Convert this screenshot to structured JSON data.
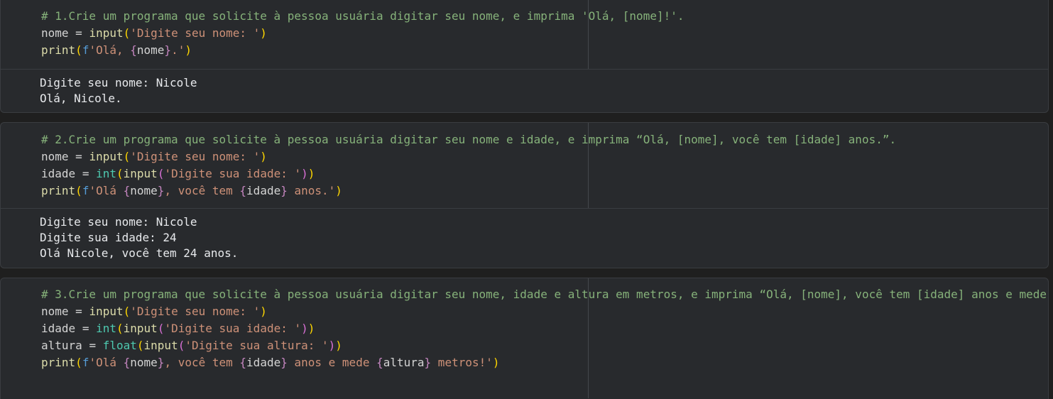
{
  "cells": [
    {
      "code": [
        "# 1.Crie um programa que solicite à pessoa usuária digitar seu nome, e imprima 'Olá, [nome]!'.",
        "nome = input('Digite seu nome: ')",
        "print(f'Olá, {nome}.')"
      ],
      "output": [
        "Digite seu nome: Nicole",
        "Olá, Nicole."
      ]
    },
    {
      "code": [
        "# 2.Crie um programa que solicite à pessoa usuária digitar seu nome e idade, e imprima “Olá, [nome], você tem [idade] anos.”.",
        "nome = input('Digite seu nome: ')",
        "idade = int(input('Digite sua idade: '))",
        "print(f'Olá {nome}, você tem {idade} anos.')"
      ],
      "output": [
        "Digite seu nome: Nicole",
        "Digite sua idade: 24",
        "Olá Nicole, você tem 24 anos."
      ]
    },
    {
      "code": [
        "# 3.Crie um programa que solicite à pessoa usuária digitar seu nome, idade e altura em metros, e imprima “Olá, [nome], você tem [idade] anos e mede",
        "nome = input('Digite seu nome: ')",
        "idade = int(input('Digite sua idade: '))",
        "altura = float(input('Digite sua altura: '))",
        "print(f'Olá {nome}, você tem {idade} anos e mede {altura} metros!')"
      ],
      "output": []
    }
  ],
  "colors": {
    "background": "#1f1f1f",
    "cell": "#282a2d",
    "comment": "#86b27a",
    "string": "#ce9178",
    "function": "#dcdcaa",
    "builtin": "#4ec9b0",
    "brace": "#c586c0",
    "paren_outer": "#ffd700",
    "paren_inner": "#da70d6",
    "output_text": "#e8eaed"
  }
}
